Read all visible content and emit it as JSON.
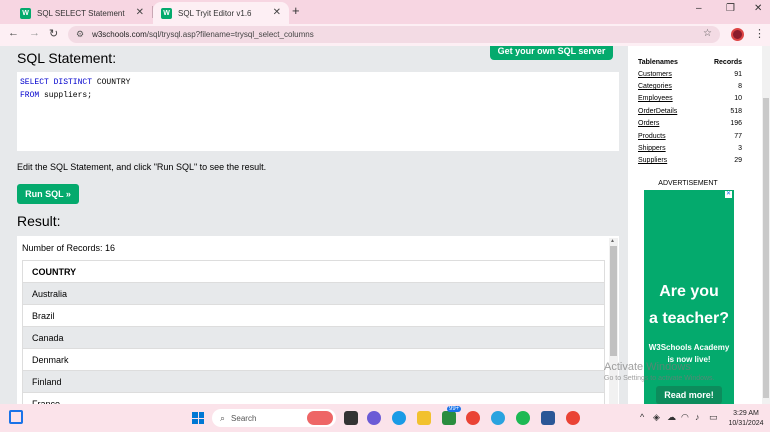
{
  "browser": {
    "tabs": [
      {
        "label": "SQL SELECT Statement",
        "favicon": "W"
      },
      {
        "label": "SQL Tryit Editor v1.6",
        "favicon": "W"
      }
    ],
    "new_tab": "+",
    "address": {
      "host": "w3schools.com",
      "path": "/sql/trysql.asp?filename=trysql_select_columns"
    },
    "controls": {
      "minimize": "–",
      "restore": "❐",
      "close": "✕"
    }
  },
  "editor": {
    "title": "SQL Statement:",
    "get_server_label": "Get your own SQL server",
    "line1_kw": "SELECT DISTINCT",
    "line1_rest": " COUNTRY",
    "line2_kw": "FROM",
    "line2_rest": " suppliers;",
    "instruction": "Edit the SQL Statement, and click \"Run SQL\" to see the result.",
    "run_label": "Run SQL »"
  },
  "result": {
    "title": "Result:",
    "count_text": "Number of Records: 16",
    "column": "COUNTRY",
    "rows": [
      "Australia",
      "Brazil",
      "Canada",
      "Denmark",
      "Finland",
      "France"
    ]
  },
  "tables_panel": {
    "col_name": "Tablenames",
    "col_records": "Records",
    "rows": [
      {
        "name": "Customers",
        "records": "91"
      },
      {
        "name": "Categories",
        "records": "8"
      },
      {
        "name": "Employees",
        "records": "10"
      },
      {
        "name": "OrderDetails",
        "records": "518"
      },
      {
        "name": "Orders",
        "records": "196"
      },
      {
        "name": "Products",
        "records": "77"
      },
      {
        "name": "Shippers",
        "records": "3"
      },
      {
        "name": "Suppliers",
        "records": "29"
      }
    ]
  },
  "ad": {
    "label": "ADVERTISEMENT",
    "headline1": "Are you",
    "headline2": "a teacher?",
    "sub1": "W3Schools Academy",
    "sub2": "is now live!",
    "button": "Read more!"
  },
  "watermark": {
    "line1": "Activate Windows",
    "line2": "Go to Settings to activate Windows."
  },
  "taskbar": {
    "search_placeholder": "Search",
    "badge": "99+",
    "time": "3:29 AM",
    "date": "10/31/2024"
  }
}
